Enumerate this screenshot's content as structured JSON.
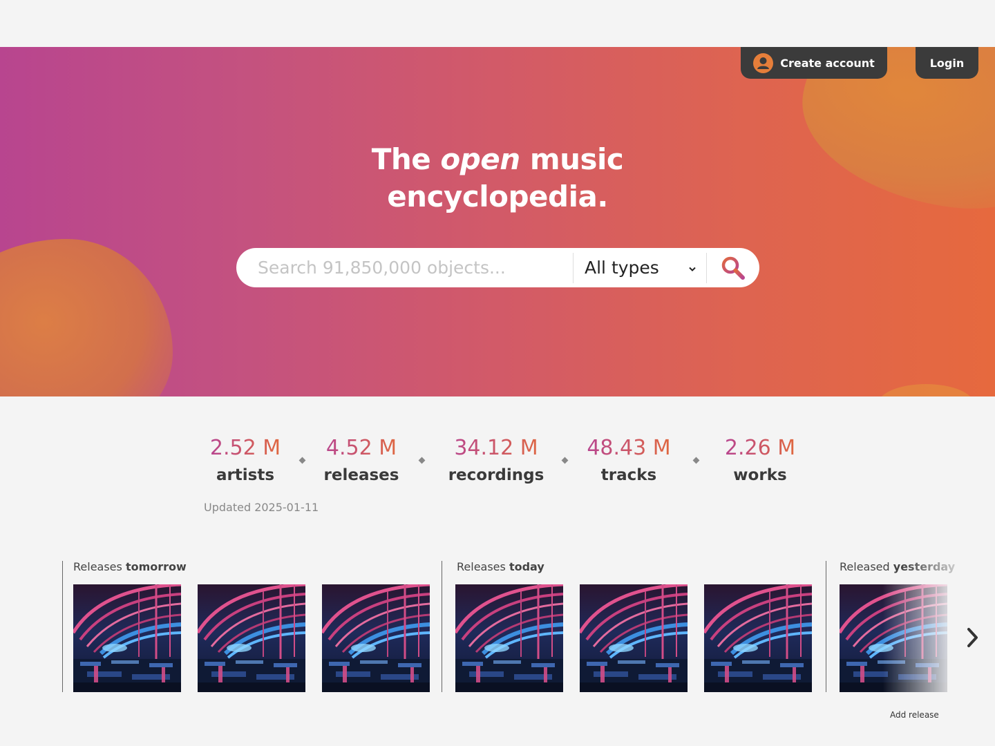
{
  "header": {
    "create_account_label": "Create account",
    "login_label": "Login"
  },
  "hero": {
    "title_word_1": "The",
    "title_word_open": "open",
    "title_word_2": "music",
    "title_line_2": "encyclopedia."
  },
  "search": {
    "placeholder": "Search 91,850,000 objects...",
    "type_selected": "All types"
  },
  "stats": {
    "items": [
      {
        "value": "2.52 M",
        "label": "artists"
      },
      {
        "value": "4.52 M",
        "label": "releases"
      },
      {
        "value": "34.12 M",
        "label": "recordings"
      },
      {
        "value": "48.43 M",
        "label": "tracks"
      },
      {
        "value": "2.26 M",
        "label": "works"
      }
    ],
    "updated": "Updated 2025-01-11"
  },
  "releases": {
    "tomorrow": {
      "prefix": "Releases ",
      "emphasis": "tomorrow"
    },
    "today": {
      "prefix": "Releases ",
      "emphasis": "today"
    },
    "yesterday": {
      "prefix": "Released ",
      "emphasis": "yesterday"
    },
    "add_release_label": "Add release"
  },
  "colors": {
    "gradient_start": "#b8458f",
    "gradient_end": "#e6693e",
    "nav_button_bg": "#3b3b3b"
  }
}
